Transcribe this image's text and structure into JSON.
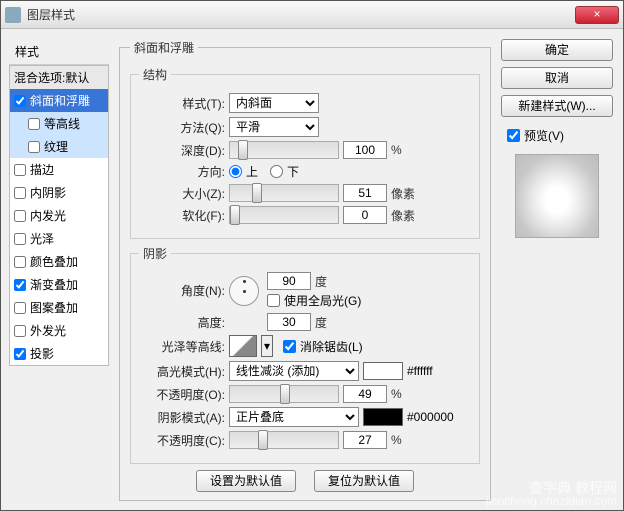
{
  "window": {
    "title": "图层样式",
    "close": "×"
  },
  "left": {
    "header": "样式",
    "blend": "混合选项:默认",
    "items": [
      {
        "label": "斜面和浮雕",
        "checked": true,
        "sel": true
      },
      {
        "label": "等高线",
        "checked": false,
        "sub": true
      },
      {
        "label": "纹理",
        "checked": false,
        "sub": true
      },
      {
        "label": "描边",
        "checked": false
      },
      {
        "label": "内阴影",
        "checked": false
      },
      {
        "label": "内发光",
        "checked": false
      },
      {
        "label": "光泽",
        "checked": false
      },
      {
        "label": "颜色叠加",
        "checked": false
      },
      {
        "label": "渐变叠加",
        "checked": true
      },
      {
        "label": "图案叠加",
        "checked": false
      },
      {
        "label": "外发光",
        "checked": false
      },
      {
        "label": "投影",
        "checked": true
      }
    ]
  },
  "bevel": {
    "group": "斜面和浮雕",
    "structure": {
      "legend": "结构",
      "style_label": "样式(T):",
      "style_val": "内斜面",
      "tech_label": "方法(Q):",
      "tech_val": "平滑",
      "depth_label": "深度(D):",
      "depth_val": "100",
      "pct": "%",
      "dir_label": "方向:",
      "up": "上",
      "down": "下",
      "size_label": "大小(Z):",
      "size_val": "51",
      "px": "像素",
      "soft_label": "软化(F):",
      "soft_val": "0"
    },
    "shading": {
      "legend": "阴影",
      "angle_label": "角度(N):",
      "angle_val": "90",
      "deg": "度",
      "global_label": "使用全局光(G)",
      "alt_label": "高度:",
      "alt_val": "30",
      "gloss_label": "光泽等高线:",
      "aa_label": "消除锯齿(L)",
      "hmode_label": "高光模式(H):",
      "hmode_val": "线性减淡 (添加)",
      "hcolor": "#ffffff",
      "hhex": "#ffffff",
      "hop_label": "不透明度(O):",
      "hop_val": "49",
      "smode_label": "阴影模式(A):",
      "smode_val": "正片叠底",
      "scolor": "#000000",
      "shex": "#000000",
      "sop_label": "不透明度(C):",
      "sop_val": "27"
    },
    "defaults": {
      "make": "设置为默认值",
      "reset": "复位为默认值"
    }
  },
  "right": {
    "ok": "确定",
    "cancel": "取消",
    "new": "新建样式(W)...",
    "preview_label": "预览(V)"
  },
  "watermark": {
    "cn": "查字典 教程网",
    "url": "jiaocheng.chazidian.com"
  }
}
